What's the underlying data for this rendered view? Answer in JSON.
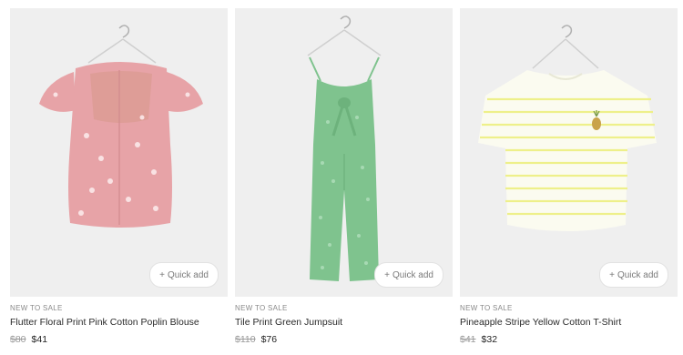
{
  "products": [
    {
      "tag": "NEW TO SALE",
      "name": "Flutter Floral Print Pink Cotton Poplin Blouse",
      "original_price": "$80",
      "sale_price": "$41",
      "quick_add_label": "Quick add"
    },
    {
      "tag": "NEW TO SALE",
      "name": "Tile Print Green Jumpsuit",
      "original_price": "$110",
      "sale_price": "$76",
      "quick_add_label": "Quick add"
    },
    {
      "tag": "NEW TO SALE",
      "name": "Pineapple Stripe Yellow Cotton T-Shirt",
      "original_price": "$41",
      "sale_price": "$32",
      "quick_add_label": "Quick add"
    }
  ],
  "colors": {
    "image_bg": "#efefef",
    "pink_blouse": "#e7a3a7",
    "green_jumpsuit": "#7fc38e",
    "stripe_yellow": "#eef08a"
  }
}
